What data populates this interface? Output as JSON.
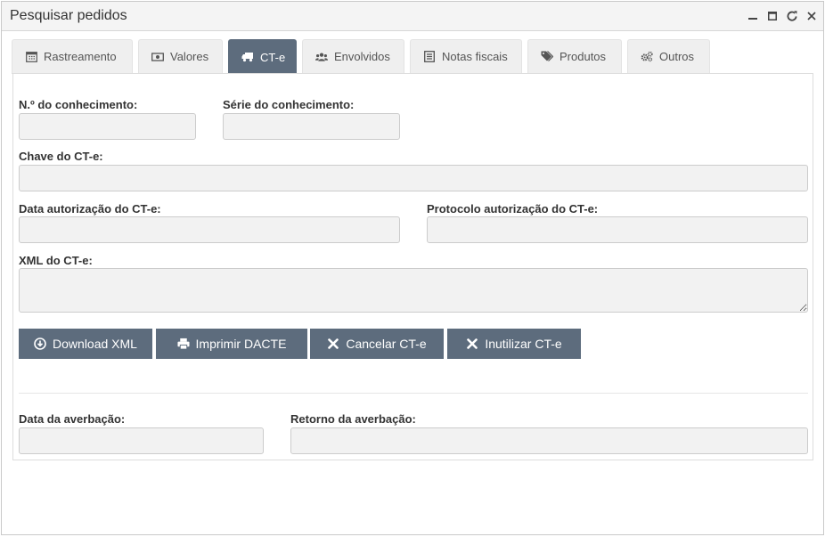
{
  "window": {
    "title": "Pesquisar pedidos",
    "controls": [
      "minimize-icon",
      "maximize-icon",
      "refresh-icon",
      "close-icon"
    ]
  },
  "tabs": [
    {
      "label": "Rastreamento",
      "icon": "calendar-icon",
      "active": false
    },
    {
      "label": "Valores",
      "icon": "money-icon",
      "active": false
    },
    {
      "label": "CT-e",
      "icon": "truck-icon",
      "active": true
    },
    {
      "label": "Envolvidos",
      "icon": "users-icon",
      "active": false
    },
    {
      "label": "Notas fiscais",
      "icon": "list-icon",
      "active": false
    },
    {
      "label": "Produtos",
      "icon": "tags-icon",
      "active": false
    },
    {
      "label": "Outros",
      "icon": "gears-icon",
      "active": false
    }
  ],
  "form": {
    "numero_conhecimento": {
      "label": "N.º do conhecimento:",
      "value": ""
    },
    "serie_conhecimento": {
      "label": "Série do conhecimento:",
      "value": ""
    },
    "chave_cte": {
      "label": "Chave do CT-e:",
      "value": ""
    },
    "data_autorizacao": {
      "label": "Data autorização do CT-e:",
      "value": ""
    },
    "protocolo_autorizacao": {
      "label": "Protocolo autorização do CT-e:",
      "value": ""
    },
    "xml_cte": {
      "label": "XML do CT-e:",
      "value": ""
    },
    "data_averbacao": {
      "label": "Data da averbação:",
      "value": ""
    },
    "retorno_averbacao": {
      "label": "Retorno da averbação:",
      "value": ""
    }
  },
  "actions": {
    "download_xml": {
      "label": "Download XML",
      "icon": "download-icon"
    },
    "imprimir_dacte": {
      "label": "Imprimir DACTE",
      "icon": "print-icon"
    },
    "cancelar_cte": {
      "label": "Cancelar CT-e",
      "icon": "x-icon"
    },
    "inutilizar_cte": {
      "label": "Inutilizar CT-e",
      "icon": "x-icon"
    }
  },
  "colors": {
    "accent": "#5d6c7d",
    "input_bg": "#f2f2f2",
    "tab_bg": "#efefef"
  }
}
